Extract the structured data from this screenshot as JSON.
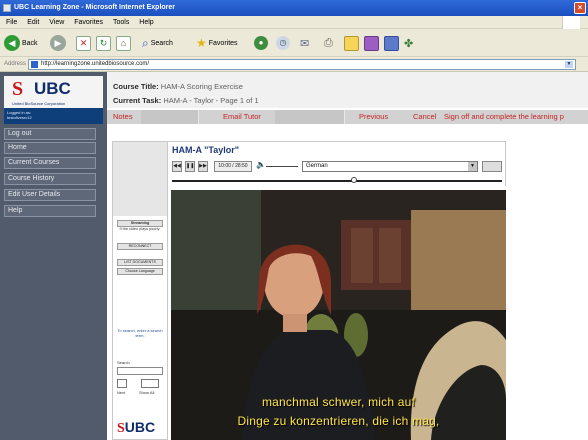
{
  "window": {
    "title": "UBC Learning Zone - Microsoft Internet Explorer",
    "close_glyph": "×"
  },
  "menu": [
    "File",
    "Edit",
    "View",
    "Favorites",
    "Tools",
    "Help"
  ],
  "toolbar": {
    "back_label": "Back",
    "search_label": "Search",
    "favorites_label": "Favorites"
  },
  "address": {
    "label": "Address",
    "url": "http://learningzone.unitedbiosource.com/"
  },
  "sidebar": {
    "logo_mark": "S",
    "logo_text": "UBC",
    "logo_subtitle": "United BioSource Corporation",
    "logged_in_label": "Logged in as:",
    "logged_in_user": "testofivesrc12",
    "items": [
      "Log out",
      "Home",
      "Current Courses",
      "Course History",
      "Edit User Details",
      "Help"
    ]
  },
  "course": {
    "title_label": "Course Title:",
    "title_value": "HAM-A Scoring Exercise",
    "task_label": "Current Task:",
    "task_value": "HAM-A - Taylor - Page 1 of 1"
  },
  "actions": {
    "notes": "Notes",
    "email_tutor": "Email Tutor",
    "previous": "Previous",
    "cancel": "Cancel",
    "sign_off": "Sign off and complete the learning p"
  },
  "player": {
    "video_title": "HAM-A \"Taylor\"",
    "time": "10:00 / 28:50",
    "language": "German",
    "volume_icon": "speaker-icon",
    "position_fraction": 0.55
  },
  "side_panel": {
    "streaming_label": "Streaming",
    "streaming_note": "If the video plays poorly:",
    "reconnect_label": "RECONNECT",
    "list_documents_label": "LIST DOCUMENTS",
    "choose_language_label": "Choose Language",
    "search_hint": "To search, enter a search term.",
    "search_label": "Search",
    "next_label": "Next",
    "show_all_label": "Show All"
  },
  "subtitles": {
    "line1": "manchmal schwer, mich auf",
    "line2": "Dinge zu konzentrieren, die ich mag,"
  },
  "colors": {
    "nav_bg": "#525b6c",
    "brand_red": "#c8171e",
    "brand_blue": "#0f2d6b",
    "action_red": "#c42424",
    "subtitle_yellow": "#ffe44a"
  }
}
